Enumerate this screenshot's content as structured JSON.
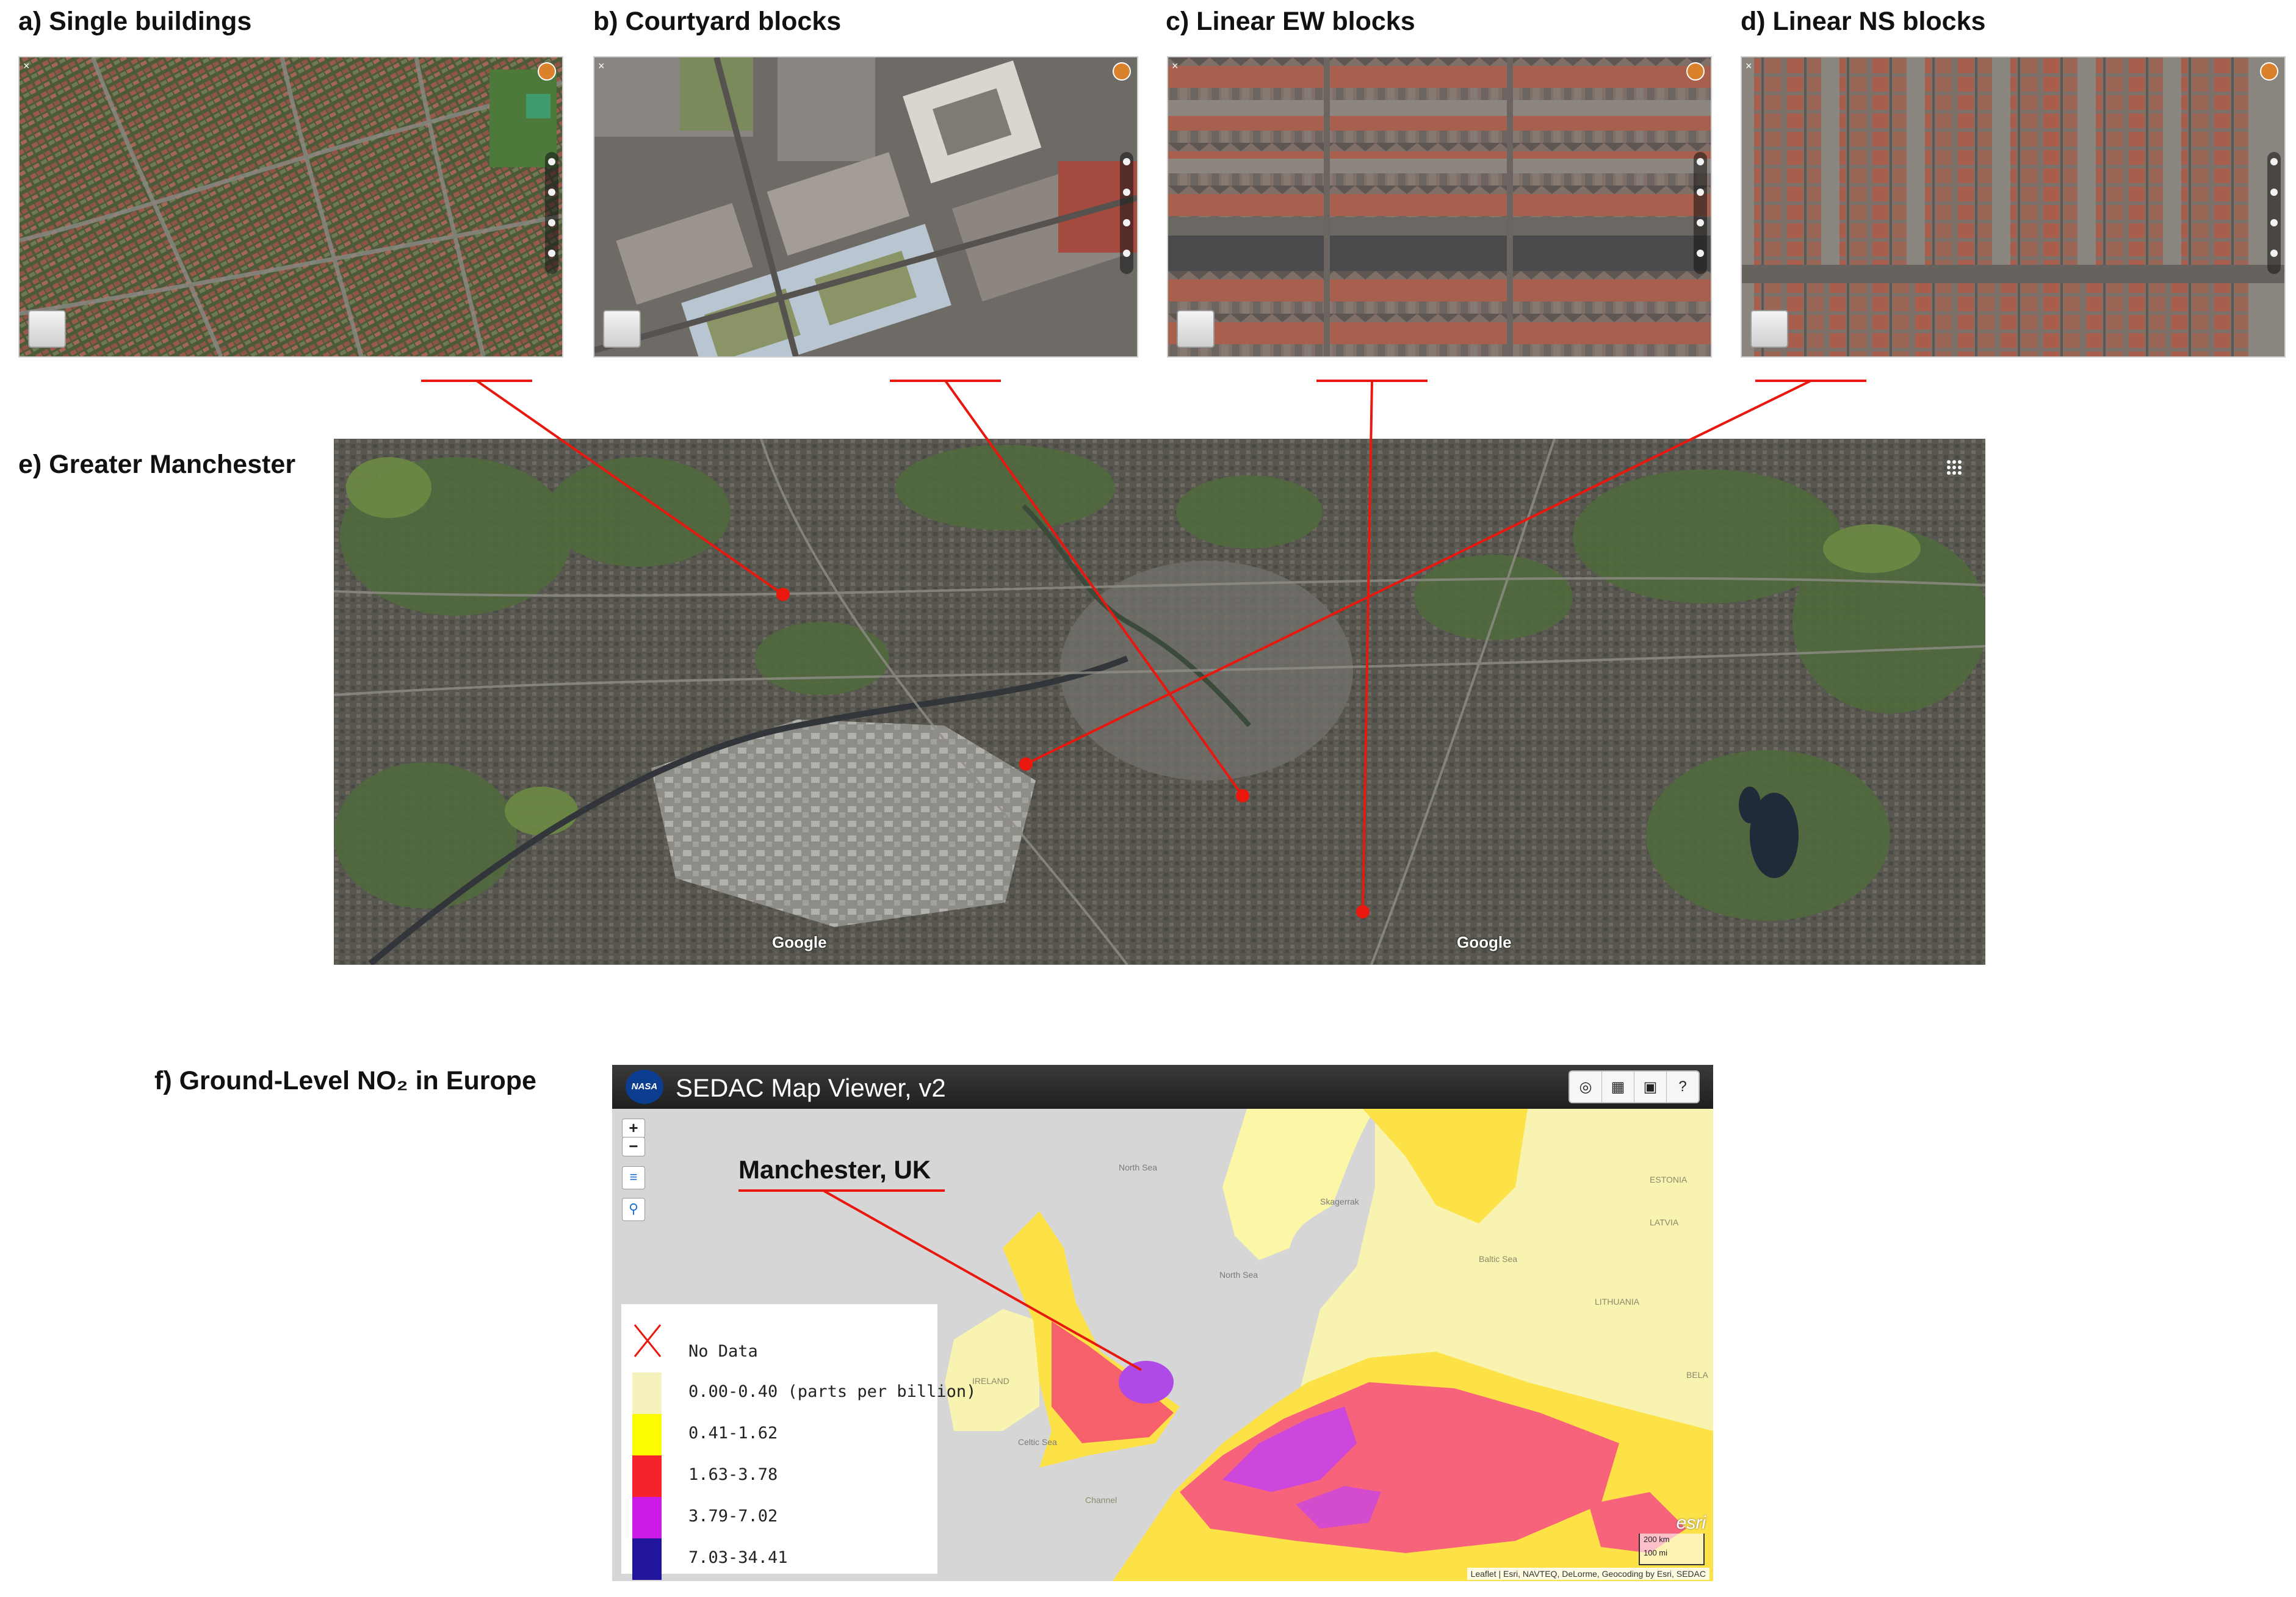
{
  "panels": {
    "a": {
      "title": "a) Single buildings"
    },
    "b": {
      "title": "b) Courtyard blocks"
    },
    "c": {
      "title": "c) Linear EW blocks"
    },
    "d": {
      "title": "d) Linear NS blocks"
    },
    "e": {
      "title": "e) Greater Manchester",
      "google_marks": [
        "Google",
        "Google"
      ]
    },
    "f": {
      "title": "f) Ground-Level NO₂ in Europe"
    }
  },
  "viewer": {
    "title": "SEDAC Map Viewer, v2",
    "logo": "NASA",
    "toolbar_icons": [
      "globe-icon",
      "grid-icon",
      "image-icon",
      "help-icon"
    ],
    "zoom_in": "+",
    "zoom_out": "−",
    "callout": "Manchester, UK",
    "attribution": "Leaflet | Esri, NAVTEQ, DeLorme, Geocoding by Esri, SEDAC",
    "scale": [
      "200 km",
      "100 mi"
    ],
    "esri": "esri",
    "place_labels": [
      "North Sea",
      "Skagerrak",
      "North Sea",
      "Baltic Sea",
      "IRELAND",
      "Celtic Sea",
      "Channel",
      "LATVIA",
      "LITHUANIA",
      "ESTONIA",
      "BELA"
    ]
  },
  "legend": {
    "nodata_label": "No Data",
    "items": [
      {
        "label": "0.00-0.40 (parts per billion)",
        "color": "#f5f2bd"
      },
      {
        "label": "0.41-1.62",
        "color": "#fcfc00"
      },
      {
        "label": "1.63-3.78",
        "color": "#f5232a"
      },
      {
        "label": "3.79-7.02",
        "color": "#c91be3"
      },
      {
        "label": "7.03-34.41",
        "color": "#20159b"
      }
    ]
  },
  "colors": {
    "connector": "#e8180f",
    "marker": "#e8180f"
  }
}
